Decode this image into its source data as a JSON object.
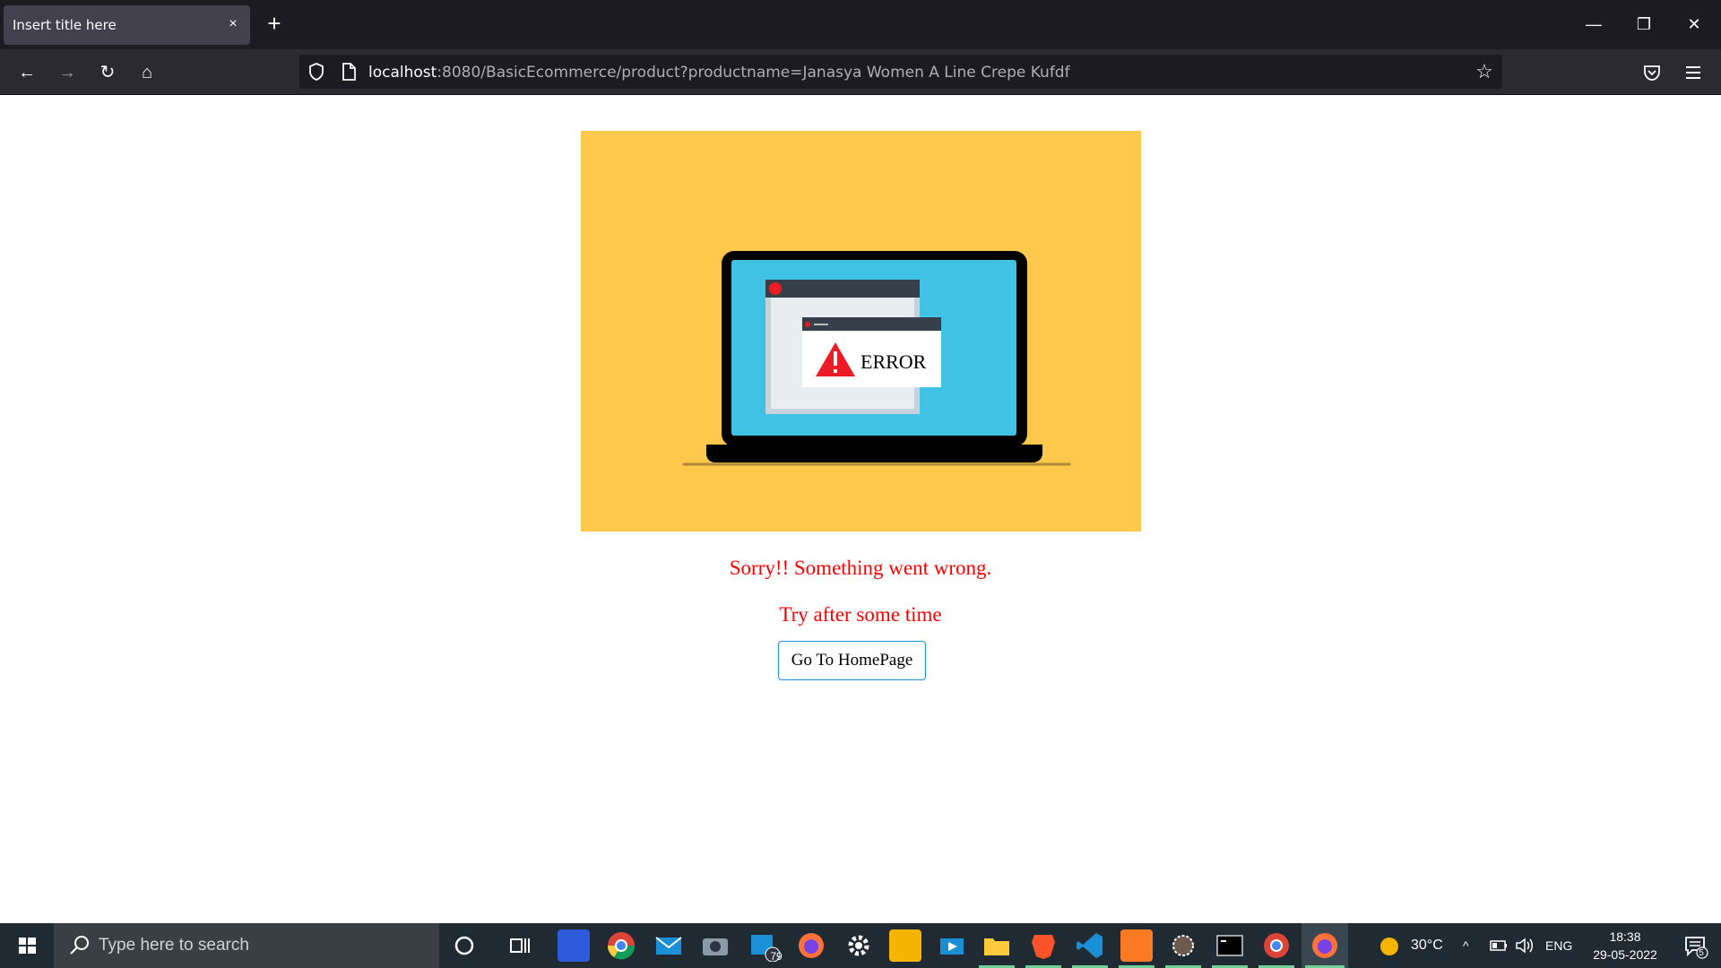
{
  "tab": {
    "title": "Insert title here",
    "close": "×"
  },
  "new_tab": "+",
  "window": {
    "minimize": "—",
    "restore": "❐",
    "close": "✕"
  },
  "nav": {
    "back": "←",
    "forward": "→",
    "reload": "↻",
    "home": "⌂"
  },
  "url": {
    "host": "localhost",
    "rest": ":8080/BasicEcommerce/product?productname=Janasya Women A Line Crepe Kufdf"
  },
  "bookmark_star": "☆",
  "error_image": {
    "label": "ERROR"
  },
  "messages": {
    "line1": "Sorry!! Something went wrong.",
    "line2": "Try after some time"
  },
  "home_button": "Go To HomePage",
  "taskbar": {
    "search_placeholder": "Type here to search",
    "mail_badge": "79",
    "temperature": "30°C",
    "language": "ENG",
    "time": "18:38",
    "date": "29-05-2022",
    "notification_count": "5"
  },
  "colors": {
    "error_bg": "#fec84c",
    "message": "#ff0000",
    "button_border": "#1a8fd6"
  }
}
